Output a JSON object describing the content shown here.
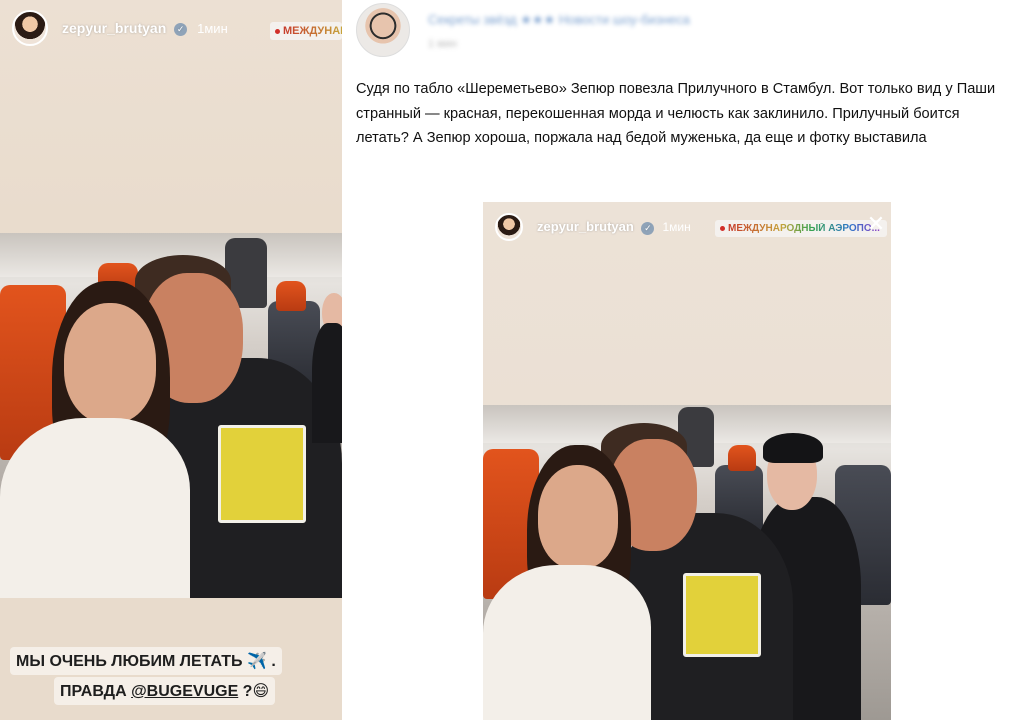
{
  "story_left": {
    "username": "zepyur_brutyan",
    "time": "1мин",
    "location": "МЕЖДУНАРОДНЫЙ АЭРОПО...",
    "caption_line1": "МЫ ОЧЕНЬ ЛЮБИМ ЛЕТАТЬ",
    "caption_emoji1": "✈️",
    "caption_after1": ".",
    "caption_line2_prefix": "ПРАВДА ",
    "caption_mention": "@BUGEVUGE",
    "caption_line2_suffix": " ?",
    "caption_emoji2": "😄"
  },
  "post": {
    "channel_title": "Секреты звёзд ★★★ Новости шоу-бизнеса",
    "channel_subtitle": "1 мин",
    "text": "Судя по табло «Шереметьево» Зепюр повезла Прилучного в Стамбул. Вот только вид у Паши странный — красная, перекошенная морда и челюсть как заклинило. Прилучный боится летать? А Зепюр хороша, поржала над бедой муженька, да еще и фотку выставила"
  },
  "story_inner": {
    "username": "zepyur_brutyan",
    "time": "1мин",
    "location": "МЕЖДУНАРОДНЫЙ АЭРОПО...",
    "close_glyph": "✕"
  },
  "colors": {
    "story_bg": "#e9dccd",
    "link_blue": "#3a71b8",
    "seat_orange": "#e2541d"
  }
}
